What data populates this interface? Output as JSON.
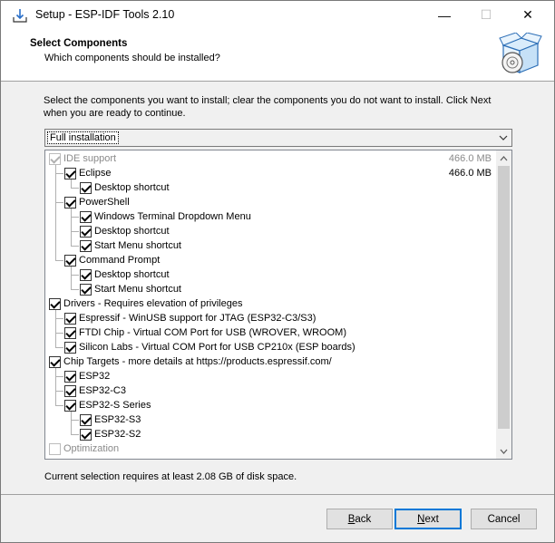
{
  "window": {
    "title": "Setup - ESP-IDF Tools 2.10",
    "minimize_glyph": "—",
    "maximize_glyph": "☐",
    "close_glyph": "✕"
  },
  "header": {
    "title": "Select Components",
    "subtitle": "Which components should be installed?",
    "logo_icon": "software-box-icon"
  },
  "instruction": "Select the components you want to install; clear the components you do not want to install. Click Next when you are ready to continue.",
  "install_type": {
    "selected": "Full installation"
  },
  "components": [
    {
      "label": "IDE support",
      "level": 0,
      "checked": true,
      "disabled": true,
      "size": "466.0 MB"
    },
    {
      "label": "Eclipse",
      "level": 1,
      "checked": true,
      "disabled": false,
      "size": "466.0 MB"
    },
    {
      "label": "Desktop shortcut",
      "level": 2,
      "checked": true,
      "disabled": false,
      "size": ""
    },
    {
      "label": "PowerShell",
      "level": 1,
      "checked": true,
      "disabled": false,
      "size": ""
    },
    {
      "label": "Windows Terminal Dropdown Menu",
      "level": 2,
      "checked": true,
      "disabled": false,
      "size": ""
    },
    {
      "label": "Desktop shortcut",
      "level": 2,
      "checked": true,
      "disabled": false,
      "size": ""
    },
    {
      "label": "Start Menu shortcut",
      "level": 2,
      "checked": true,
      "disabled": false,
      "size": ""
    },
    {
      "label": "Command Prompt",
      "level": 1,
      "checked": true,
      "disabled": false,
      "size": ""
    },
    {
      "label": "Desktop shortcut",
      "level": 2,
      "checked": true,
      "disabled": false,
      "size": ""
    },
    {
      "label": "Start Menu shortcut",
      "level": 2,
      "checked": true,
      "disabled": false,
      "size": ""
    },
    {
      "label": "Drivers - Requires elevation of privileges",
      "level": 0,
      "checked": true,
      "disabled": false,
      "size": ""
    },
    {
      "label": "Espressif - WinUSB support for JTAG (ESP32-C3/S3)",
      "level": 1,
      "checked": true,
      "disabled": false,
      "size": ""
    },
    {
      "label": "FTDI Chip - Virtual COM Port for USB (WROVER, WROOM)",
      "level": 1,
      "checked": true,
      "disabled": false,
      "size": ""
    },
    {
      "label": "Silicon Labs - Virtual COM Port for USB CP210x (ESP boards)",
      "level": 1,
      "checked": true,
      "disabled": false,
      "size": ""
    },
    {
      "label": "Chip Targets - more details at https://products.espressif.com/",
      "level": 0,
      "checked": true,
      "disabled": false,
      "size": ""
    },
    {
      "label": "ESP32",
      "level": 1,
      "checked": true,
      "disabled": false,
      "size": ""
    },
    {
      "label": "ESP32-C3",
      "level": 1,
      "checked": true,
      "disabled": false,
      "size": ""
    },
    {
      "label": "ESP32-S Series",
      "level": 1,
      "checked": true,
      "disabled": false,
      "size": ""
    },
    {
      "label": "ESP32-S3",
      "level": 2,
      "checked": true,
      "disabled": false,
      "size": ""
    },
    {
      "label": "ESP32-S2",
      "level": 2,
      "checked": true,
      "disabled": false,
      "size": ""
    },
    {
      "label": "Optimization",
      "level": 0,
      "checked": false,
      "disabled": true,
      "size": ""
    }
  ],
  "disk_space": "Current selection requires at least 2.08 GB of disk space.",
  "buttons": {
    "back_accel": "B",
    "back_rest": "ack",
    "next_accel": "N",
    "next_rest": "ext",
    "cancel": "Cancel"
  },
  "colors": {
    "default_button_border": "#0078d7",
    "window_bg": "#f0f0f0"
  }
}
